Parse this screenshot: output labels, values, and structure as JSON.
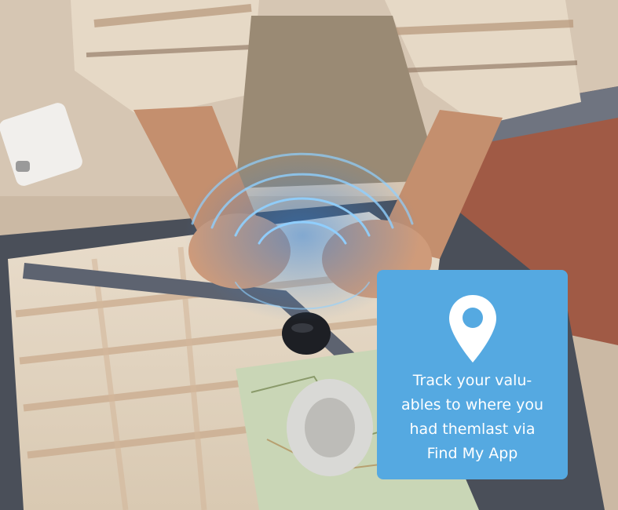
{
  "callout": {
    "icon": "location-pin-icon",
    "background_color": "#55a9e1",
    "text_color": "#ffffff",
    "text_lines": [
      "Track your valu-",
      "ables to where you",
      "had themlast via",
      "Find My App"
    ]
  }
}
